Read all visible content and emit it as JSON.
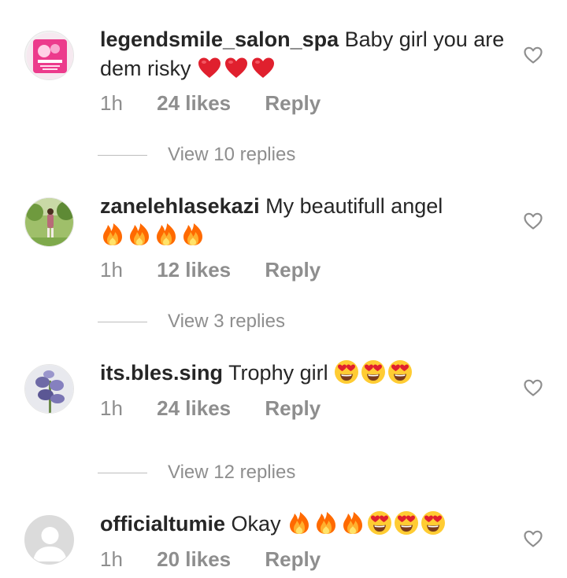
{
  "comments": [
    {
      "username": "legendsmile_salon_spa",
      "text": "Baby girl you are dem risky",
      "emojis": [
        "red-heart",
        "red-heart",
        "red-heart"
      ],
      "time": "1h",
      "likes": "24 likes",
      "reply": "Reply",
      "view_replies": "View 10 replies"
    },
    {
      "username": "zanelehlasekazi",
      "text": "My beautifull angel",
      "emojis": [
        "fire",
        "fire",
        "fire",
        "fire"
      ],
      "time": "1h",
      "likes": "12 likes",
      "reply": "Reply",
      "view_replies": "View 3 replies"
    },
    {
      "username": "its.bles.sing",
      "text": "Trophy girl",
      "emojis": [
        "heart-eyes",
        "heart-eyes",
        "heart-eyes"
      ],
      "time": "1h",
      "likes": "24 likes",
      "reply": "Reply",
      "view_replies": "View 12 replies"
    },
    {
      "username": "officialtumie",
      "text": "Okay",
      "emojis": [
        "fire",
        "fire",
        "fire",
        "heart-eyes",
        "heart-eyes",
        "heart-eyes"
      ],
      "time": "1h",
      "likes": "20 likes",
      "reply": "Reply"
    }
  ],
  "icons": {
    "like": "heart-outline-icon"
  },
  "colors": {
    "text": "#262626",
    "muted": "#8e8e8e",
    "heart_emoji": "#e0202e",
    "fire": "#ff7a1a"
  }
}
